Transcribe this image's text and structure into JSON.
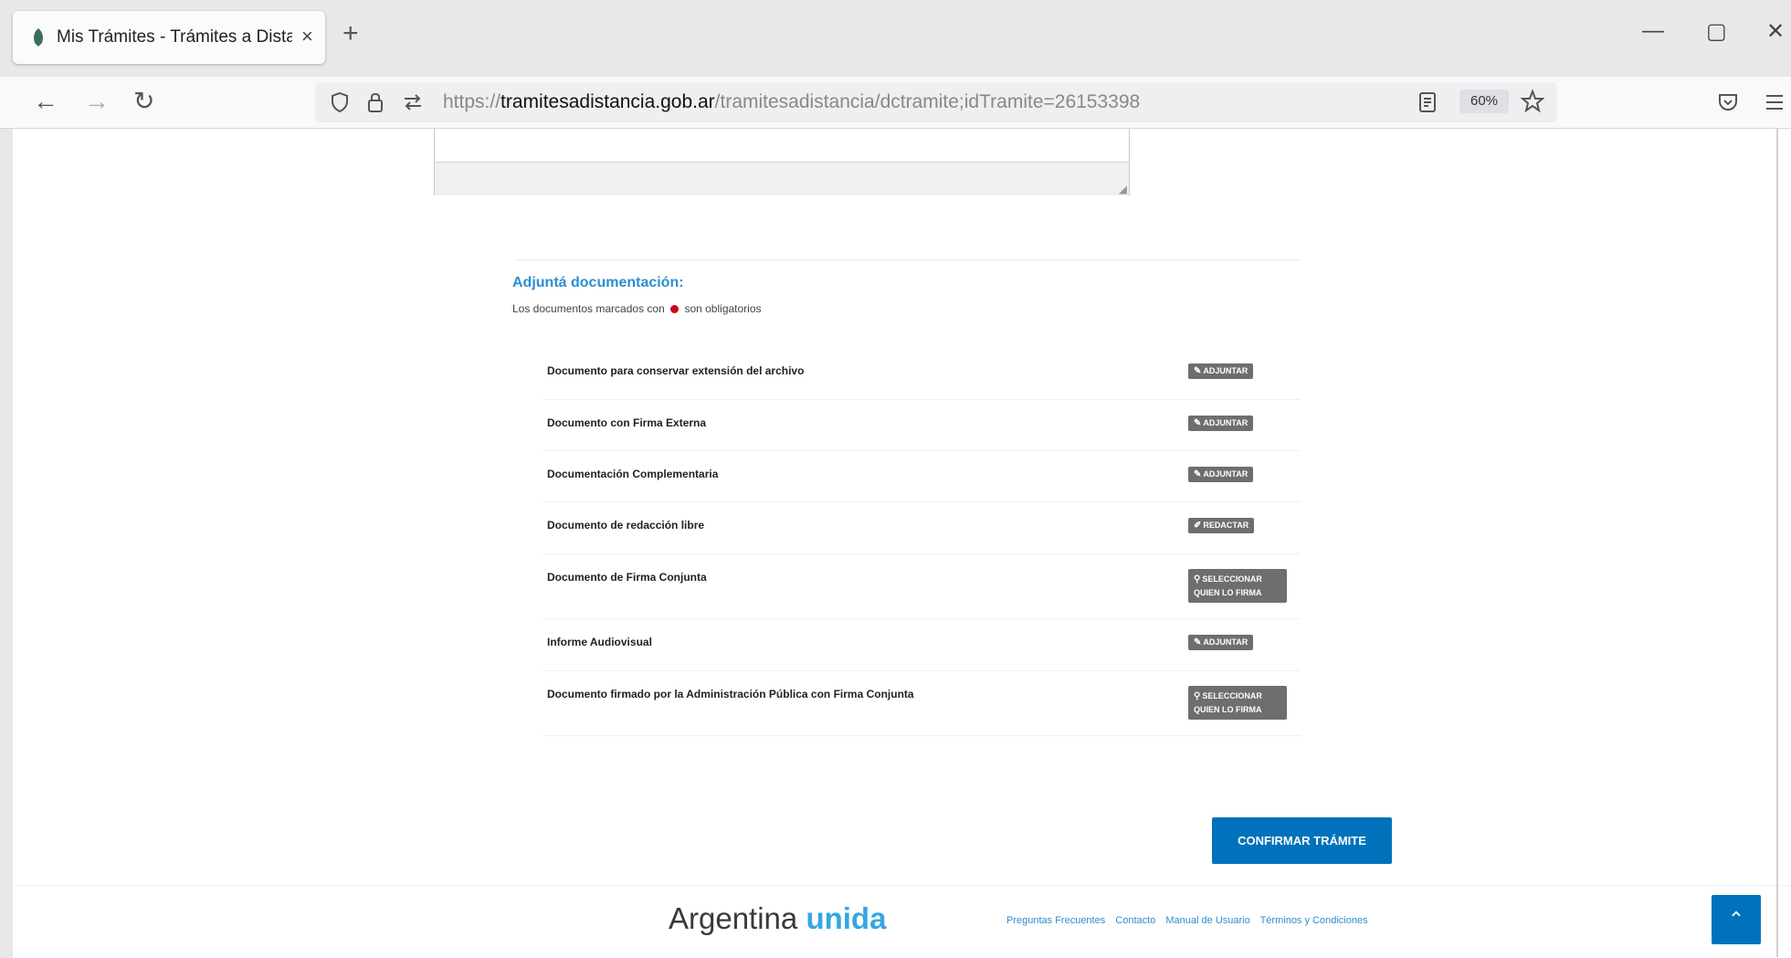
{
  "browser": {
    "tab_title": "Mis Trámites - Trámites a Dista",
    "tab_close": "×",
    "new_tab": "+",
    "window_controls": {
      "minimize": "—",
      "restore": "▢",
      "close": "✕"
    },
    "nav": {
      "back": "←",
      "forward": "→",
      "reload": "↻"
    },
    "url_prefix": "https://",
    "url_host": "tramitesadistancia.gob.ar",
    "url_path": "/tramitesadistancia/dctramite;idTramite=26153398",
    "zoom": "60%",
    "icons": {
      "shield": "shield-icon",
      "lock": "lock-icon",
      "permissions": "permissions-icon",
      "reader": "reader-view-icon",
      "bookmark": "bookmark-star-icon",
      "pocket": "pocket-icon",
      "menu": "hamburger-menu-icon"
    }
  },
  "section": {
    "title": "Adjuntá documentación:",
    "note_before": "Los documentos marcados con",
    "note_after": "son obligatorios"
  },
  "documents": [
    {
      "label": "Documento para conservar extensión del archivo",
      "action": "Adjuntar",
      "glyph": "✎"
    },
    {
      "label": "Documento con Firma Externa",
      "action": "Adjuntar",
      "glyph": "✎"
    },
    {
      "label": "Documentación Complementaria",
      "action": "Adjuntar",
      "glyph": "✎"
    },
    {
      "label": "Documento de redacción libre",
      "action": "Redactar",
      "glyph": "✐"
    },
    {
      "label": "Documento de Firma Conjunta",
      "action": "Seleccionar quien lo firma",
      "glyph": "⚲"
    },
    {
      "label": "Informe Audiovisual",
      "action": "Adjuntar",
      "glyph": "✎"
    },
    {
      "label": "Documento firmado por la Administración Pública con Firma Conjunta",
      "action": "Seleccionar quien lo firma",
      "glyph": "⚲"
    }
  ],
  "confirm_button": "CONFIRMAR TRÁMITE",
  "footer": {
    "brand_main": "Argentina",
    "brand_accent": "unida",
    "links": [
      "Preguntas Frecuentes",
      "Contacto",
      "Manual de Usuario",
      "Términos y Condiciones"
    ],
    "back_to_top": "⌃"
  },
  "colors": {
    "accent": "#2a8fcf",
    "primary_button": "#0072bb",
    "doc_button": "#6e6e6e",
    "required_dot": "#d0021b"
  }
}
